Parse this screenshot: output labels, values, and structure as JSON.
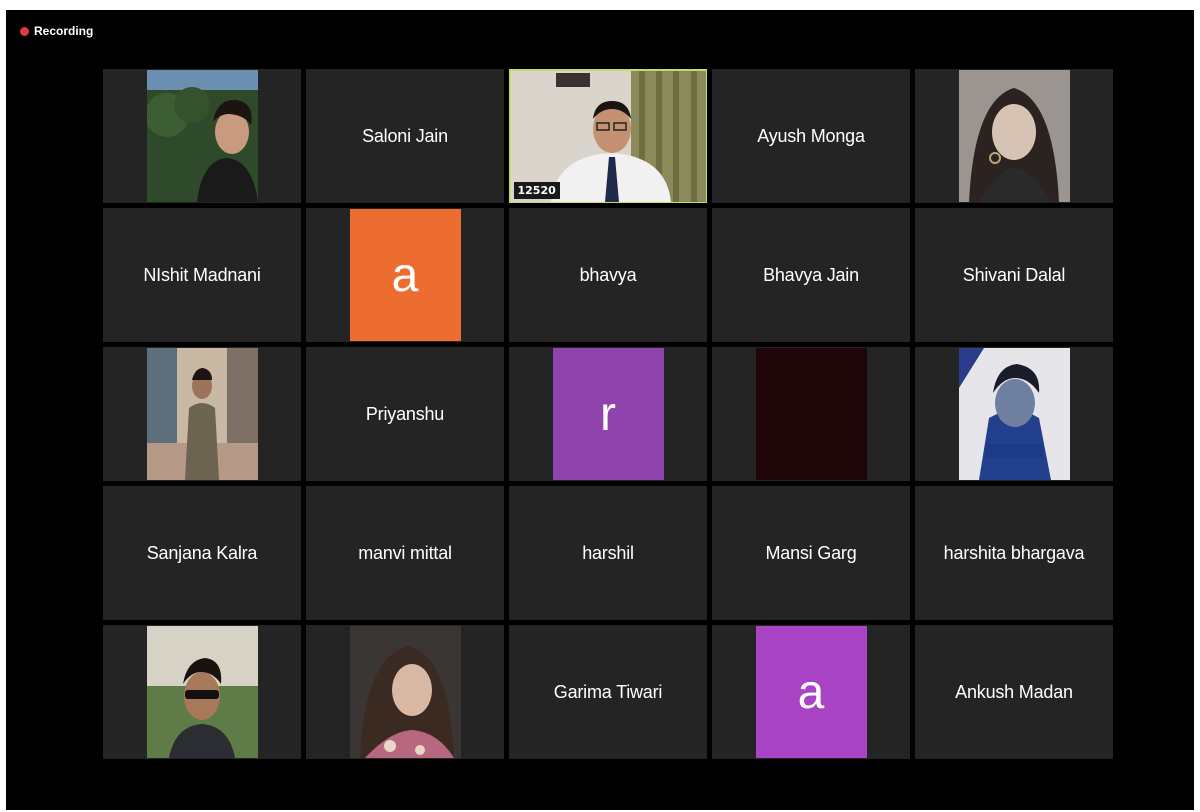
{
  "recording": {
    "label": "Recording",
    "color": "#e03b3b"
  },
  "active_color": "#c9d96a",
  "tiles": [
    {
      "type": "photo",
      "scene": "hills-boy"
    },
    {
      "type": "name",
      "label": "Saloni Jain"
    },
    {
      "type": "video",
      "badge": "12520"
    },
    {
      "type": "name",
      "label": "Ayush Monga"
    },
    {
      "type": "photo",
      "scene": "girl-bw"
    },
    {
      "type": "name",
      "label": "NIshit Madnani"
    },
    {
      "type": "letter",
      "label": "a",
      "color": "#ec6d2f"
    },
    {
      "type": "name",
      "label": "bhavya"
    },
    {
      "type": "name",
      "label": "Bhavya Jain"
    },
    {
      "type": "name",
      "label": "Shivani Dalal"
    },
    {
      "type": "photo",
      "scene": "street-boy"
    },
    {
      "type": "name",
      "label": "Priyanshu"
    },
    {
      "type": "letter",
      "label": "r",
      "color": "#8e43ad"
    },
    {
      "type": "photo",
      "scene": "dark"
    },
    {
      "type": "photo",
      "scene": "streamer"
    },
    {
      "type": "name",
      "label": "Sanjana Kalra"
    },
    {
      "type": "name",
      "label": "manvi mittal"
    },
    {
      "type": "name",
      "label": "harshil"
    },
    {
      "type": "name",
      "label": "Mansi Garg"
    },
    {
      "type": "name",
      "label": "harshita bhargava"
    },
    {
      "type": "photo",
      "scene": "sunglasses-boy"
    },
    {
      "type": "photo",
      "scene": "car-girl"
    },
    {
      "type": "name",
      "label": "Garima Tiwari"
    },
    {
      "type": "letter",
      "label": "a",
      "color": "#a944c4"
    },
    {
      "type": "name",
      "label": "Ankush Madan"
    }
  ]
}
